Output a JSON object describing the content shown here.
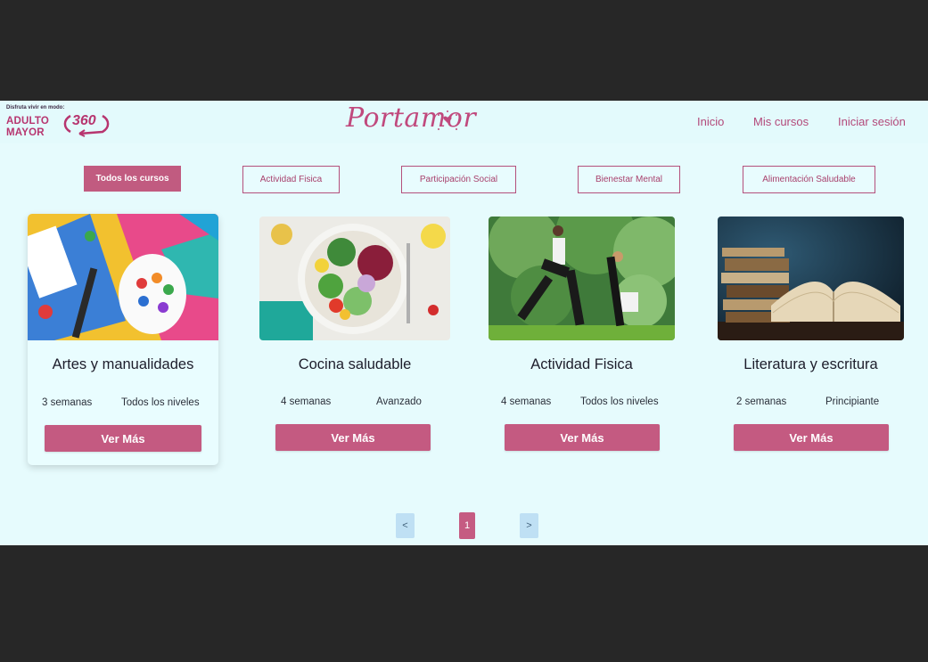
{
  "badge": {
    "tagline": "Disfruta vivir en modo:",
    "line1": "ADULTO",
    "line2": "MAYOR",
    "number": "360"
  },
  "brand": {
    "name": "Portamor"
  },
  "nav": {
    "inicio": "Inicio",
    "mis_cursos": "Mis cursos",
    "login": "Iniciar sesión"
  },
  "filters": [
    {
      "label": "Todos los cursos",
      "active": true
    },
    {
      "label": "Actividad Fisica",
      "active": false
    },
    {
      "label": "Participación Social",
      "active": false
    },
    {
      "label": "Bienestar Mental",
      "active": false
    },
    {
      "label": "Alimentación Saludable",
      "active": false
    }
  ],
  "courses": [
    {
      "title": "Artes y manualidades",
      "duration": "3 semanas",
      "level": "Todos los niveles",
      "button": "Ver Más"
    },
    {
      "title": "Cocina saludable",
      "duration": "4 semanas",
      "level": "Avanzado",
      "button": "Ver Más"
    },
    {
      "title": "Actividad Fisica",
      "duration": "4 semanas",
      "level": "Todos los niveles",
      "button": "Ver Más"
    },
    {
      "title": "Literatura y escritura",
      "duration": "2 semanas",
      "level": "Principiante",
      "button": "Ver Más"
    }
  ],
  "pagination": {
    "prev": "<",
    "current": "1",
    "next": ">"
  },
  "colors": {
    "accent": "#c45a81",
    "background": "#e6fbfd",
    "frame": "#272727",
    "pagination_nav": "#bfe0f4"
  }
}
